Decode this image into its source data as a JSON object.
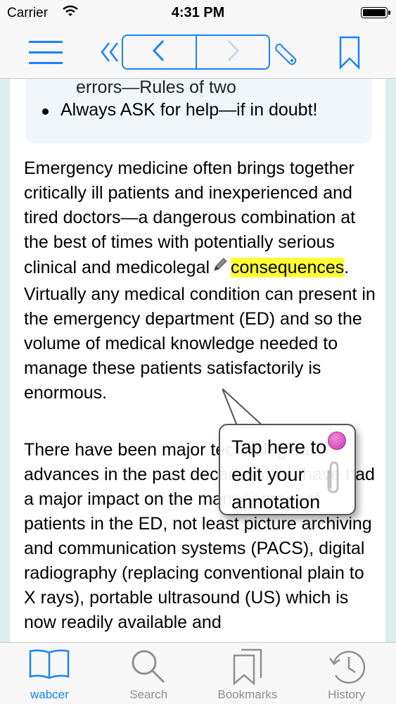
{
  "status_bar": {
    "carrier": "Carrier",
    "time": "4:31 PM"
  },
  "toolbar": {
    "menu_icon": "hamburger-menu-icon",
    "back_icon": "double-chevron-left-icon",
    "prev_icon": "chevron-left-icon",
    "next_icon": "chevron-right-icon",
    "tools_icon": "wrench-icon",
    "bookmark_icon": "bookmark-icon",
    "accent_color": "#1a82fb"
  },
  "content": {
    "boxout_cut_line": "errors—Rules of two",
    "boxout_items": [
      "Always ASK for help—if in doubt!"
    ],
    "paragraph1_before": "Emergency medicine often brings together critically ill patients and inexperienced and tired doctors—a dangerous combination at the best of times with potentially serious clinical and medicolegal",
    "highlighted_word": "consequences",
    "paragraph1_after": ". Virtually any medical condition can present in the emergency department (ED) and so the volume of medical knowledge needed to manage these patients satisfactorily is enormous.",
    "paragraph2": "There have been major technological advances in the past decade which have had a major impact on the management of patients in the ED, not least picture archiving and communication systems (PACS), digital radiography (replacing conventional plain to X rays), portable ultrasound (US) which is now readily available and",
    "highlight_color": "#ffff33"
  },
  "tooltip": {
    "message": "Tap here to edit your annotation"
  },
  "tabbar": {
    "tabs": [
      {
        "label": "wabcer",
        "icon": "open-book-icon",
        "active": true
      },
      {
        "label": "Search",
        "icon": "magnifier-icon",
        "active": false
      },
      {
        "label": "Bookmarks",
        "icon": "bookmarks-icon",
        "active": false
      },
      {
        "label": "History",
        "icon": "clock-history-icon",
        "active": false
      }
    ],
    "active_color": "#1a82fb",
    "inactive_color": "#8e8e93"
  }
}
